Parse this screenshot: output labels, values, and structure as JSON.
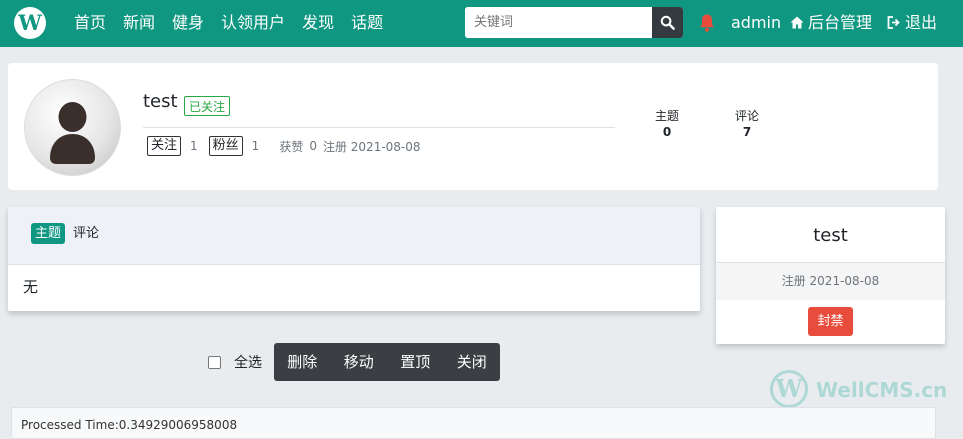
{
  "navbar": {
    "logo_letter": "W",
    "links": [
      "首页",
      "新闻",
      "健身",
      "认领用户",
      "发现",
      "话题"
    ],
    "search_placeholder": "关键词",
    "user": "admin",
    "admin_label": "后台管理",
    "logout_label": "退出",
    "accent_color": "#0f9781"
  },
  "profile": {
    "username": "test",
    "followed_badge": "已关注",
    "follow_label": "关注",
    "follow_count": "1",
    "fans_label": "粉丝",
    "fans_count": "1",
    "likes_label": "获赞",
    "likes_count": "0",
    "register_text": "注册 2021-08-08",
    "stats": [
      {
        "label": "主题",
        "value": "0"
      },
      {
        "label": "评论",
        "value": "7"
      }
    ]
  },
  "tabs": {
    "active": "主题",
    "other": "评论",
    "empty_text": "无"
  },
  "user_card": {
    "name": "test",
    "register_text": "注册 2021-08-08",
    "ban_label": "封禁"
  },
  "bulk": {
    "select_all": "全选",
    "buttons": [
      "删除",
      "移动",
      "置顶",
      "关闭"
    ]
  },
  "footer": {
    "text": "Processed Time:0.34929006958008"
  },
  "watermark": {
    "letter": "W",
    "text": "WellCMS.cn"
  }
}
